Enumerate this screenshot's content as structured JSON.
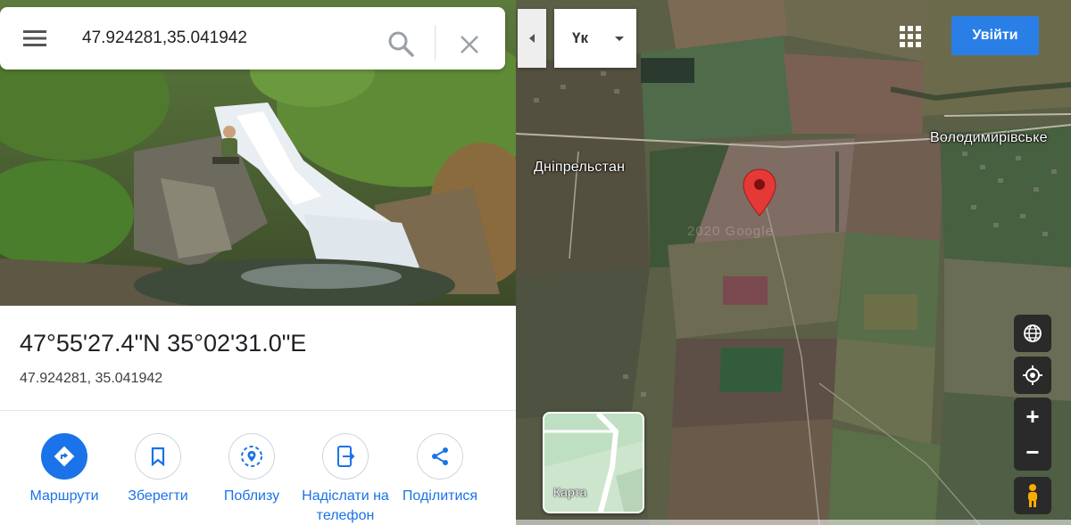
{
  "search": {
    "value": "47.924281,35.041942",
    "menu_icon": "hamburger-menu-icon",
    "search_icon": "search-icon",
    "close_icon": "close-icon"
  },
  "place": {
    "dms": "47°55'27.4\"N 35°02'31.0\"E",
    "decimal": "47.924281, 35.041942"
  },
  "actions": [
    {
      "label": "Маршрути",
      "icon": "directions-icon",
      "primary": true
    },
    {
      "label": "Зберегти",
      "icon": "bookmark-icon",
      "primary": false
    },
    {
      "label": "Поблизу",
      "icon": "nearby-icon",
      "primary": false
    },
    {
      "label": "Надіслати на телефон",
      "icon": "send-to-phone-icon",
      "primary": false
    },
    {
      "label": "Поділитися",
      "icon": "share-icon",
      "primary": false
    }
  ],
  "map": {
    "language_code": "Үк",
    "signin_label": "Увійти",
    "labels": {
      "town_1": "Дніпрельстан",
      "town_2": "Володимирівське"
    },
    "minimap_label": "Карта",
    "watermark": "2020 Google",
    "controls": {
      "layers": "globe-icon",
      "locate": "my-location-icon",
      "zoom_in": "+",
      "zoom_out": "−",
      "pegman": "pegman-icon"
    }
  },
  "colors": {
    "accent": "#1a73e8",
    "signin": "#2a7fe6",
    "pin": "#e53935"
  }
}
